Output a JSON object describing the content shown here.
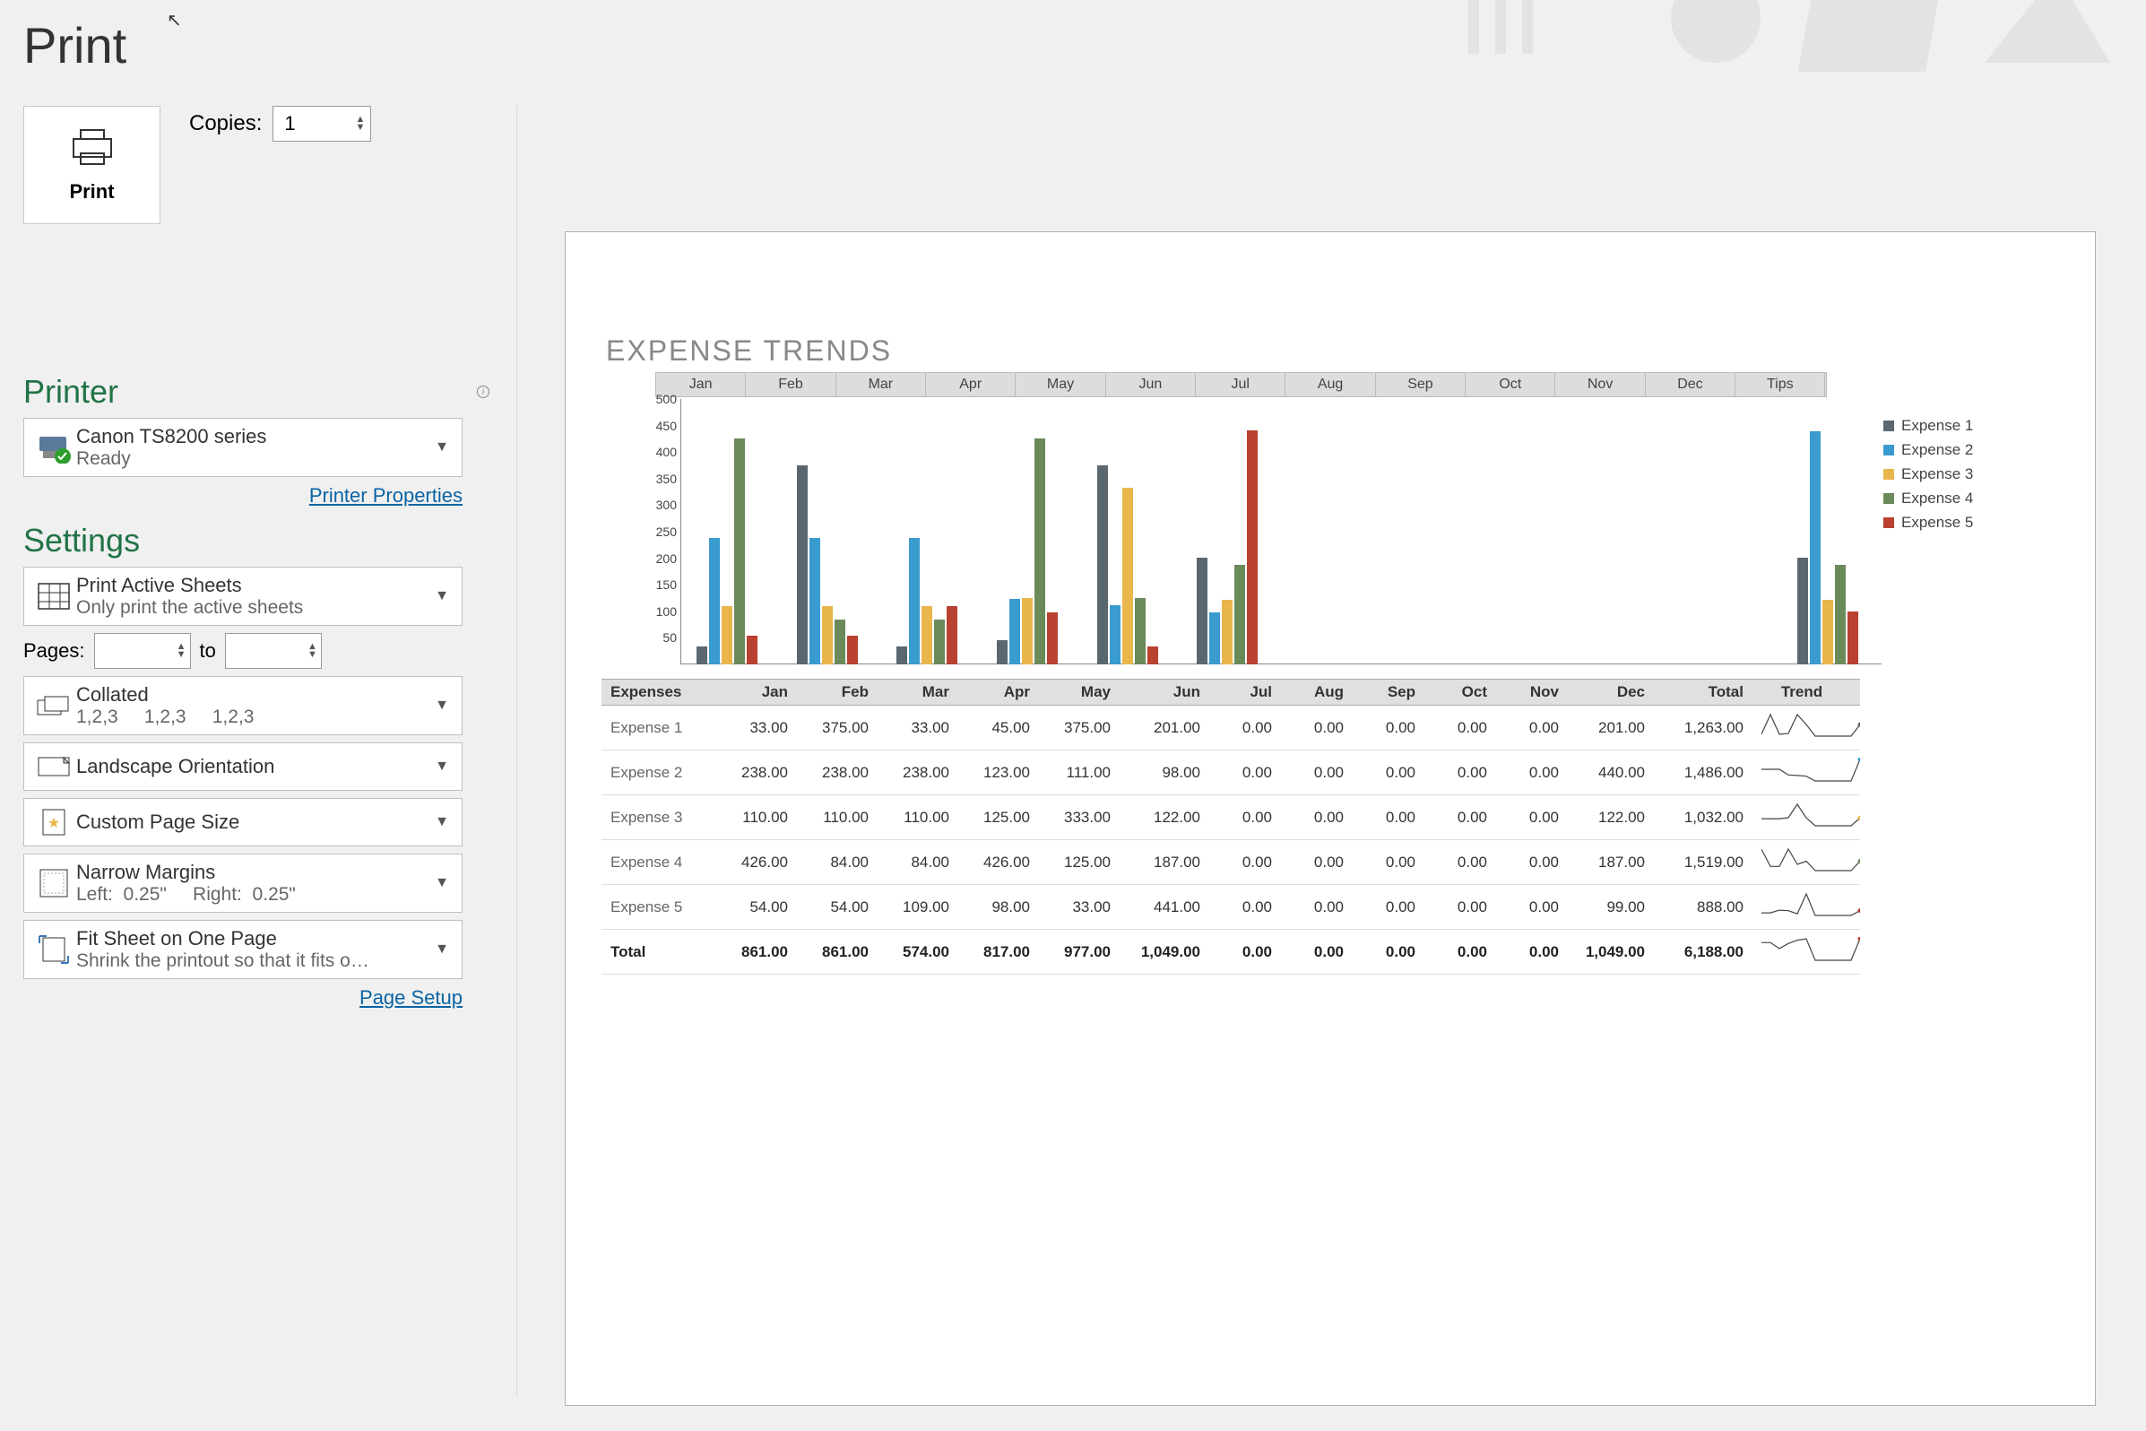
{
  "title": "Print",
  "print_button_label": "Print",
  "copies": {
    "label": "Copies:",
    "value": "1"
  },
  "printer": {
    "heading": "Printer",
    "name": "Canon TS8200 series",
    "status": "Ready",
    "properties_link": "Printer Properties"
  },
  "settings": {
    "heading": "Settings",
    "print_what": {
      "title": "Print Active Sheets",
      "sub": "Only print the active sheets"
    },
    "pages": {
      "label": "Pages:",
      "to_label": "to",
      "from": "",
      "to": ""
    },
    "collation": {
      "title": "Collated",
      "sub": "1,2,3     1,2,3     1,2,3"
    },
    "orientation": {
      "title": "Landscape Orientation"
    },
    "page_size": {
      "title": "Custom Page Size"
    },
    "margins": {
      "title": "Narrow Margins",
      "sub": "Left:  0.25\"     Right:  0.25\""
    },
    "scaling": {
      "title": "Fit Sheet on One Page",
      "sub": "Shrink the printout so that it fits o…"
    },
    "page_setup_link": "Page Setup"
  },
  "preview": {
    "chart_title": "EXPENSE TRENDS",
    "months": [
      "Jan",
      "Feb",
      "Mar",
      "Apr",
      "May",
      "Jun",
      "Jul",
      "Aug",
      "Sep",
      "Oct",
      "Nov",
      "Dec",
      "Tips"
    ],
    "table_headers": [
      "Expenses",
      "Jan",
      "Feb",
      "Mar",
      "Apr",
      "May",
      "Jun",
      "Jul",
      "Aug",
      "Sep",
      "Oct",
      "Nov",
      "Dec",
      "Total",
      "Trend"
    ],
    "legend": [
      "Expense 1",
      "Expense 2",
      "Expense 3",
      "Expense 4",
      "Expense 5"
    ],
    "rows": [
      {
        "name": "Expense 1",
        "vals": [
          "33.00",
          "375.00",
          "33.00",
          "45.00",
          "375.00",
          "201.00",
          "0.00",
          "0.00",
          "0.00",
          "0.00",
          "0.00",
          "201.00",
          "1,263.00"
        ]
      },
      {
        "name": "Expense 2",
        "vals": [
          "238.00",
          "238.00",
          "238.00",
          "123.00",
          "111.00",
          "98.00",
          "0.00",
          "0.00",
          "0.00",
          "0.00",
          "0.00",
          "440.00",
          "1,486.00"
        ]
      },
      {
        "name": "Expense 3",
        "vals": [
          "110.00",
          "110.00",
          "110.00",
          "125.00",
          "333.00",
          "122.00",
          "0.00",
          "0.00",
          "0.00",
          "0.00",
          "0.00",
          "122.00",
          "1,032.00"
        ]
      },
      {
        "name": "Expense 4",
        "vals": [
          "426.00",
          "84.00",
          "84.00",
          "426.00",
          "125.00",
          "187.00",
          "0.00",
          "0.00",
          "0.00",
          "0.00",
          "0.00",
          "187.00",
          "1,519.00"
        ]
      },
      {
        "name": "Expense 5",
        "vals": [
          "54.00",
          "54.00",
          "109.00",
          "98.00",
          "33.00",
          "441.00",
          "0.00",
          "0.00",
          "0.00",
          "0.00",
          "0.00",
          "99.00",
          "888.00"
        ]
      }
    ],
    "total_row": {
      "name": "Total",
      "vals": [
        "861.00",
        "861.00",
        "574.00",
        "817.00",
        "977.00",
        "1,049.00",
        "0.00",
        "0.00",
        "0.00",
        "0.00",
        "0.00",
        "1,049.00",
        "6,188.00"
      ]
    }
  },
  "chart_data": {
    "type": "bar",
    "title": "EXPENSE TRENDS",
    "categories": [
      "Jan",
      "Feb",
      "Mar",
      "Apr",
      "May",
      "Jun",
      "Jul",
      "Aug",
      "Sep",
      "Oct",
      "Nov",
      "Dec"
    ],
    "series": [
      {
        "name": "Expense 1",
        "color": "#5b6770",
        "values": [
          33,
          375,
          33,
          45,
          375,
          201,
          0,
          0,
          0,
          0,
          0,
          201
        ]
      },
      {
        "name": "Expense 2",
        "color": "#3a9bcf",
        "values": [
          238,
          238,
          238,
          123,
          111,
          98,
          0,
          0,
          0,
          0,
          0,
          440
        ]
      },
      {
        "name": "Expense 3",
        "color": "#e9b64c",
        "values": [
          110,
          110,
          110,
          125,
          333,
          122,
          0,
          0,
          0,
          0,
          0,
          122
        ]
      },
      {
        "name": "Expense 4",
        "color": "#6b8a5a",
        "values": [
          426,
          84,
          84,
          426,
          125,
          187,
          0,
          0,
          0,
          0,
          0,
          187
        ]
      },
      {
        "name": "Expense 5",
        "color": "#b8412f",
        "values": [
          54,
          54,
          109,
          98,
          33,
          441,
          0,
          0,
          0,
          0,
          0,
          99
        ]
      }
    ],
    "ylim": [
      0,
      500
    ],
    "yticks": [
      50,
      100,
      150,
      200,
      250,
      300,
      350,
      400,
      450,
      500
    ],
    "ylabel": "",
    "xlabel": ""
  }
}
